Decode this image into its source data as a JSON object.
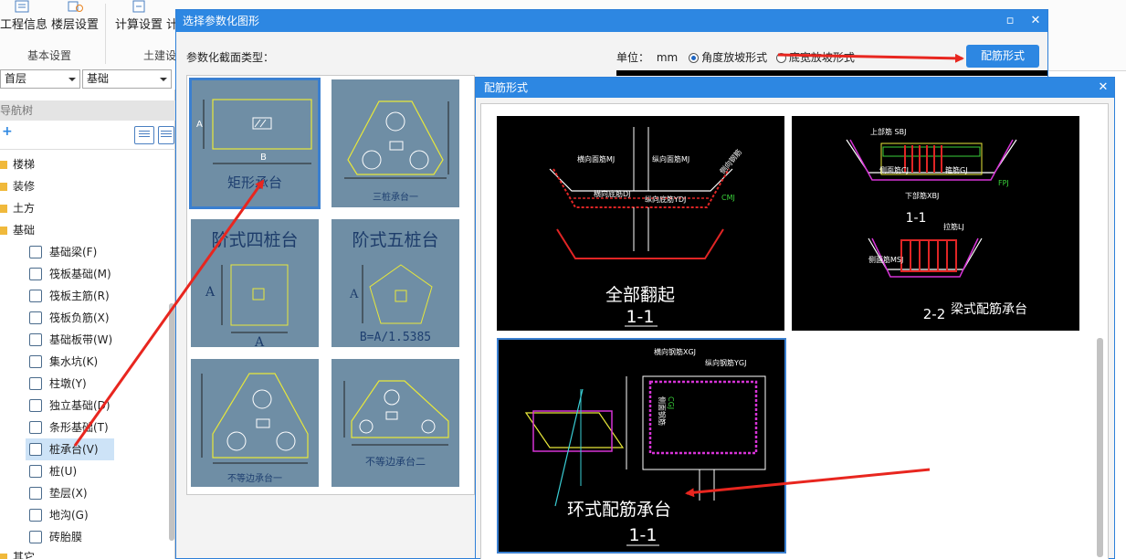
{
  "ribbon": {
    "buttons": [
      "工程信息",
      "楼层设置",
      "计算设置",
      "计"
    ],
    "groups": [
      "基本设置",
      "土建设"
    ]
  },
  "combos": {
    "floor_value": "首层",
    "category_value": "基础"
  },
  "nav": {
    "title": "导航树",
    "folders": [
      "楼梯",
      "装修",
      "土方",
      "基础"
    ],
    "items": [
      "基础梁(F)",
      "筏板基础(M)",
      "筏板主筋(R)",
      "筏板负筋(X)",
      "基础板带(W)",
      "集水坑(K)",
      "柱墩(Y)",
      "独立基础(D)",
      "条形基础(T)",
      "桩承台(V)",
      "桩(U)",
      "垫层(X)",
      "地沟(G)",
      "砖胎膜"
    ],
    "selected_item": "桩承台(V)",
    "bottom_folder": "其它"
  },
  "dialog_shape": {
    "title": "选择参数化图形",
    "section_type_label": "参数化截面类型：",
    "unit_label": "单位：",
    "unit_value": "mm",
    "radio_angle": "角度放坡形式",
    "radio_width": "底宽放坡形式",
    "radio_selected": "角度放坡形式",
    "reinforce_button": "配筋形式",
    "thumbnails": [
      {
        "caption": "矩形承台",
        "dim_a": "A",
        "dim_b": "B",
        "selected": true
      },
      {
        "caption": "三桩承台一",
        "selected": false
      },
      {
        "caption": "阶式四桩台",
        "dim_a": "A",
        "selected": false
      },
      {
        "caption": "阶式五桩台",
        "dim_a": "A",
        "formula": "B=A/1.5385",
        "selected": false
      },
      {
        "caption": "不等边承台一",
        "selected": false
      },
      {
        "caption": "不等边承台二",
        "selected": false
      }
    ]
  },
  "dialog_reinforce": {
    "title": "配筋形式",
    "cards": [
      {
        "title": "全部翻起",
        "section": "1-1",
        "labels": [
          "横向面筋MJ",
          "纵向面筋MJ",
          "横向底筋DJ",
          "纵向底筋YDJ",
          "CMJ",
          "侧向钢筋"
        ],
        "selected": false
      },
      {
        "title": "梁式配筋承台",
        "section_a": "1-1",
        "section_b": "2-2",
        "labels": [
          "上部筋 SBJ",
          "侧面筋CJ",
          "箍筋GJ",
          "下部筋XBJ",
          "拉筋LJ",
          "FPJ",
          "侧面筋MSJ"
        ],
        "selected": false
      },
      {
        "title": "环式配筋承台",
        "section": "1-1",
        "labels": [
          "横向钢筋XGJ",
          "纵向钢筋YGJ",
          "侧面钢筋",
          "CGJ"
        ],
        "selected": true
      }
    ]
  },
  "colors": {
    "title_bar": "#2d87e2",
    "thumb_bg": "#6f8ea5",
    "cad_bg": "#000000",
    "arrow": "#e8261f"
  }
}
